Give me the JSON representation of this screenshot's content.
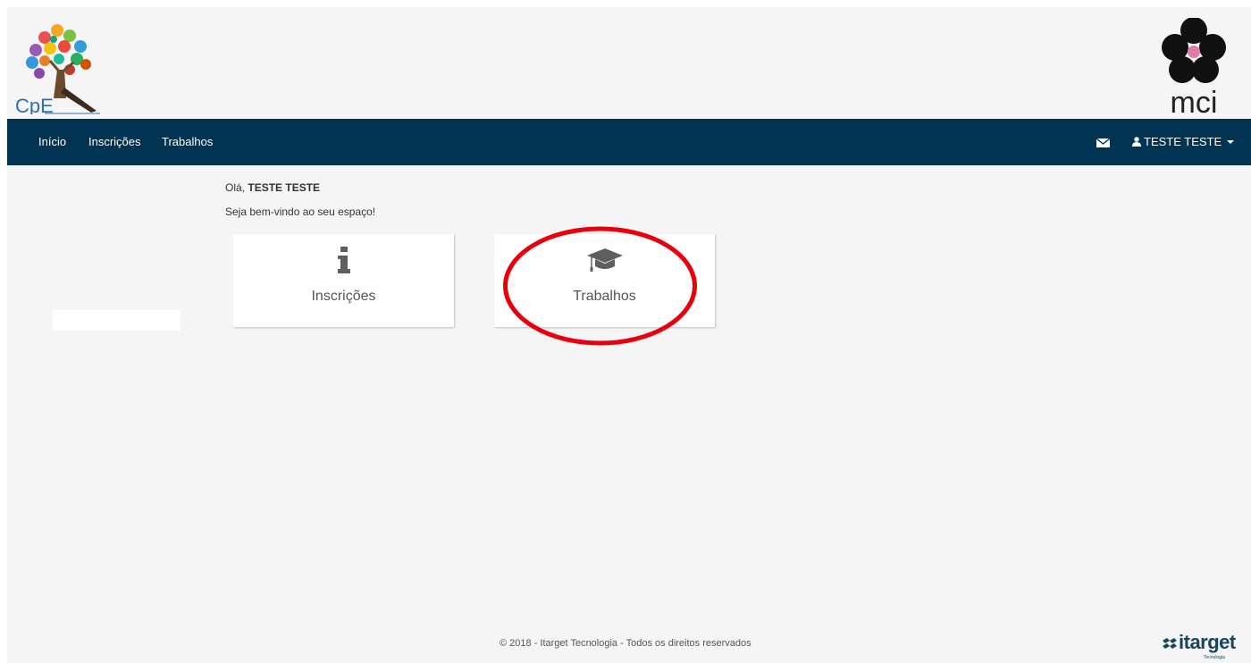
{
  "header": {
    "left_logo_text": "CpE",
    "right_logo_text": "mci"
  },
  "nav": {
    "items": [
      {
        "label": "Início"
      },
      {
        "label": "Inscrições"
      },
      {
        "label": "Trabalhos"
      }
    ],
    "mail_icon": "envelope-icon",
    "user_icon": "user-icon",
    "user_name": "TESTE TESTE"
  },
  "main": {
    "greeting_prefix": "Olá,",
    "greeting_name": "TESTE TESTE",
    "welcome": "Seja bem-vindo ao seu espaço!",
    "tiles": [
      {
        "label": "Inscrições",
        "icon": "info-icon"
      },
      {
        "label": "Trabalhos",
        "icon": "graduation-cap-icon"
      }
    ]
  },
  "footer": {
    "copyright": "© 2018 - Itarget Tecnologia - Todos os direitos reservados",
    "brand_name": "itarget",
    "brand_sub": "Tecnologia"
  },
  "colors": {
    "navbar": "#003452",
    "background": "#f5f5f5",
    "highlight_circle": "#e8000d"
  }
}
